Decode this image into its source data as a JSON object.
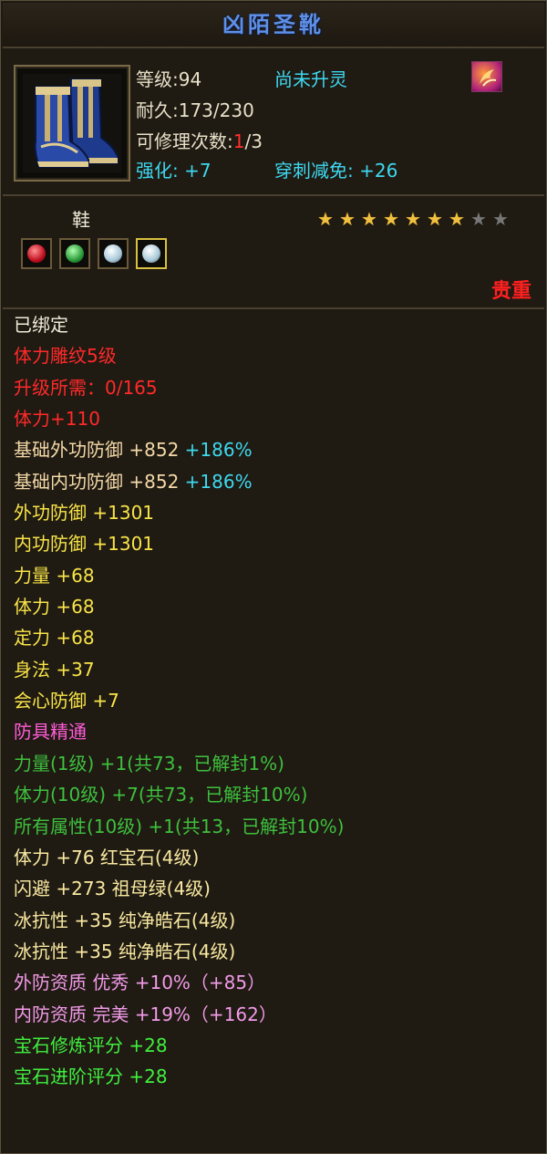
{
  "item": {
    "name": "凶陌圣靴",
    "level_label": "等级:94",
    "spirit_status": "尚未升灵",
    "durability_label": "耐久:173/230",
    "repair_label_prefix": "可修理次数:",
    "repair_used": "1",
    "repair_total": "/3",
    "enhance_label": "强化: +7",
    "pierce_label": "穿刺减免: +26",
    "type": "鞋",
    "rarity": "贵重",
    "stars_filled": 7,
    "stars_total": 9,
    "gems": [
      "red-gem-icon",
      "green-gem-icon",
      "white-gem-icon",
      "white-gem-icon"
    ]
  },
  "attributes": [
    {
      "text": "已绑定",
      "color": "white"
    },
    {
      "text": "体力雕纹5级",
      "color": "red"
    },
    {
      "text": "升级所需：0/165",
      "color": "red"
    },
    {
      "text": "体力+110",
      "color": "red"
    },
    {
      "text": "基础外功防御 +852",
      "suffix": "+186%",
      "color": "gold",
      "suffix_color": "cyan"
    },
    {
      "text": "基础内功防御 +852",
      "suffix": "+186%",
      "color": "gold",
      "suffix_color": "cyan"
    },
    {
      "text": "外功防御 +1301",
      "color": "yellow"
    },
    {
      "text": "内功防御 +1301",
      "color": "yellow"
    },
    {
      "text": "力量 +68",
      "color": "yellow"
    },
    {
      "text": "体力 +68",
      "color": "yellow"
    },
    {
      "text": "定力 +68",
      "color": "yellow"
    },
    {
      "text": "身法 +37",
      "color": "yellow"
    },
    {
      "text": "会心防御 +7",
      "color": "yellow"
    },
    {
      "text": "防具精通",
      "color": "pink"
    },
    {
      "text": "力量(1级) +1(共73，已解封1%)",
      "color": "dkgreen"
    },
    {
      "text": "体力(10级) +7(共73，已解封10%)",
      "color": "dkgreen"
    },
    {
      "text": "所有属性(10级) +1(共13，已解封10%)",
      "color": "dkgreen"
    },
    {
      "text": "体力 +76 红宝石(4级)",
      "color": "lgold"
    },
    {
      "text": "闪避 +273 祖母绿(4级)",
      "color": "lgold"
    },
    {
      "text": "冰抗性 +35 纯净皓石(4级)",
      "color": "lgold"
    },
    {
      "text": "冰抗性 +35 纯净皓石(4级)",
      "color": "lgold"
    },
    {
      "text": "外防资质  优秀 +10%（+85）",
      "color": "lpink"
    },
    {
      "text": "内防资质  完美 +19%（+162）",
      "color": "lpink"
    },
    {
      "text": "宝石修炼评分 +28",
      "color": "green"
    },
    {
      "text": "宝石进阶评分 +28",
      "color": "green"
    }
  ],
  "colors": {
    "title": "#5f8fe6",
    "rarity": "#ff2020",
    "spirit": "#3ed8f0",
    "enhance": "#3ed8f0"
  }
}
